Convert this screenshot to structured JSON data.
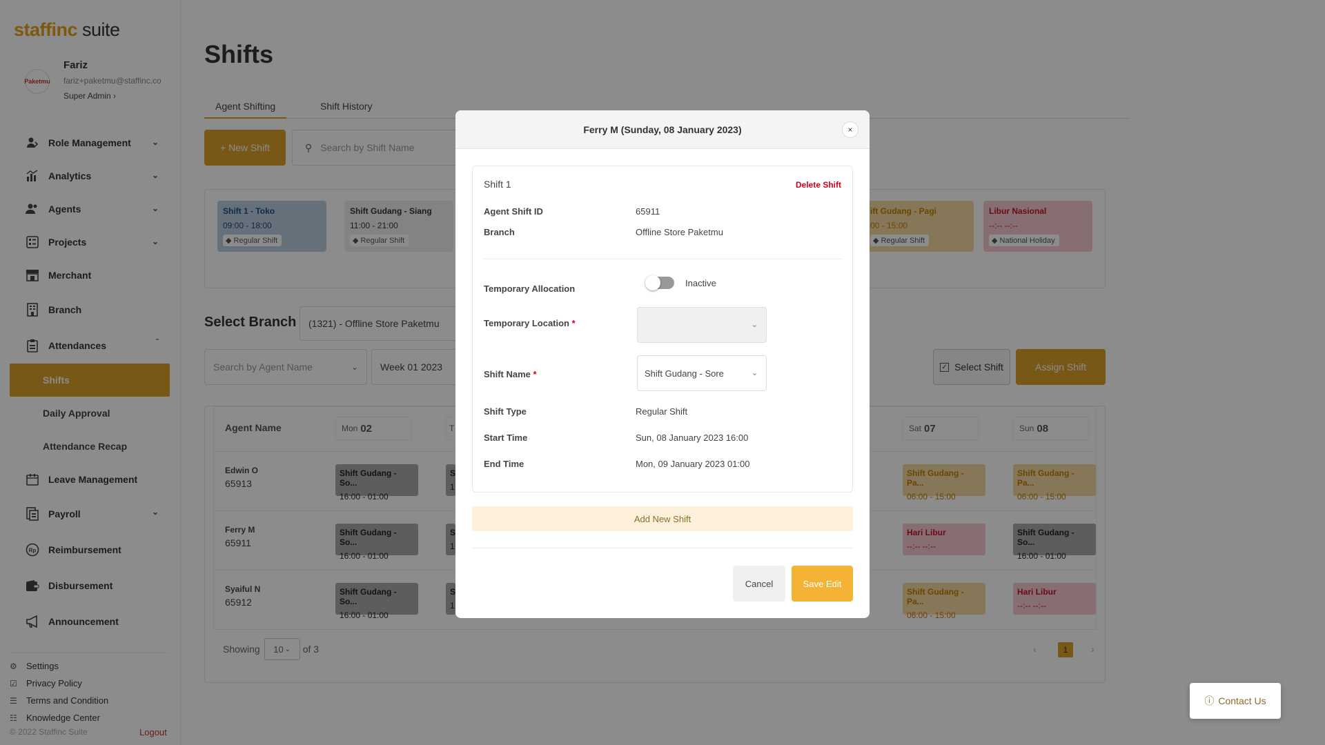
{
  "brand": {
    "logo_a": "staffinc",
    "logo_b": " suite"
  },
  "profile": {
    "name": "Fariz",
    "email": "fariz+paketmu@staffinc.co",
    "role": "Super Admin ›",
    "avatar_text": "Paketmu"
  },
  "sidebar": {
    "items": [
      {
        "label": "Role Management",
        "icon": "role-icon"
      },
      {
        "label": "Analytics",
        "icon": "chart-icon"
      },
      {
        "label": "Agents",
        "icon": "users-icon"
      },
      {
        "label": "Projects",
        "icon": "projects-icon"
      },
      {
        "label": "Merchant",
        "icon": "store-icon"
      },
      {
        "label": "Branch",
        "icon": "building-icon"
      },
      {
        "label": "Attendances",
        "icon": "clipboard-icon"
      },
      {
        "label": "Leave Management",
        "icon": "calendar-icon"
      },
      {
        "label": "Payroll",
        "icon": "payroll-icon"
      },
      {
        "label": "Reimbursement",
        "icon": "rp-icon"
      },
      {
        "label": "Disbursement",
        "icon": "wallet-icon"
      },
      {
        "label": "Announcement",
        "icon": "megaphone-icon"
      }
    ],
    "sub_items": [
      "Shifts",
      "Daily Approval",
      "Attendance Recap"
    ],
    "footer": [
      "Settings",
      "Privacy Policy",
      "Terms and Condition",
      "Knowledge Center"
    ],
    "copyright": "© 2022 Staffinc Suite",
    "logout": "Logout"
  },
  "page": {
    "title": "Shifts",
    "tabs": [
      "Agent Shifting",
      "Shift History"
    ],
    "new_shift": "+  New Shift",
    "search_placeholder": "Search by Shift Name",
    "shift_cards": [
      {
        "name": "Shift 1 - Toko",
        "time": "09:00 - 18:00",
        "tag": "Regular Shift"
      },
      {
        "name": "Shift Gudang - Siang",
        "time": "11:00 - 21:00",
        "tag": "Regular Shift"
      },
      {
        "name": "ift Gudang - Pagi",
        "time": "00 - 15:00",
        "tag": "Regular Shift"
      },
      {
        "name": "Libur Nasional",
        "time": "--:-- --:--",
        "tag": "National Holiday"
      }
    ],
    "select_branch": "Select Branch",
    "branch_value": "(1321) - Offline Store Paketmu",
    "agent_search": "Search by Agent Name",
    "week": "Week 01 2023",
    "select_shift": "Select Shift",
    "assign_shift": "Assign Shift",
    "table": {
      "agent_header": "Agent Name",
      "days": [
        {
          "d": "Mon",
          "n": "02"
        },
        {
          "d": "Sat",
          "n": "07"
        },
        {
          "d": "Sun",
          "n": "08"
        }
      ],
      "tue_partial": "T",
      "rows": [
        {
          "name": "Edwin O",
          "id": "65913",
          "mon": {
            "n": "Shift Gudang - So...",
            "t": "16:00 - 01:00"
          },
          "sat": {
            "n": "Shift Gudang - Pa...",
            "t": "06:00 - 15:00"
          },
          "sun": {
            "n": "Shift Gudang - Pa...",
            "t": "06:00 - 15:00"
          }
        },
        {
          "name": "Ferry M",
          "id": "65911",
          "mon": {
            "n": "Shift Gudang - So...",
            "t": "16:00 - 01:00"
          },
          "sat": {
            "n": "Hari Libur",
            "t": "--:-- --:--"
          },
          "sun": {
            "n": "Shift Gudang - So...",
            "t": "16:00 - 01:00"
          }
        },
        {
          "name": "Syaiful N",
          "id": "65912",
          "mon": {
            "n": "Shift Gudang - So...",
            "t": "16:00 - 01:00"
          },
          "sat": {
            "n": "Shift Gudang - Pa...",
            "t": "06:00 - 15:00"
          },
          "sun": {
            "n": "Hari Libur",
            "t": "--:-- --:--"
          }
        }
      ],
      "partial_letters": [
        "S",
        "1"
      ],
      "showing": "Showing",
      "page_size": "10",
      "of_total": "of 3",
      "page": "1"
    },
    "contact": "Contact Us"
  },
  "modal": {
    "title": "Ferry M (Sunday, 08 January 2023)",
    "close": "×",
    "shift_title": "Shift 1",
    "delete": "Delete Shift",
    "agent_shift_id_label": "Agent Shift ID",
    "agent_shift_id": "65911",
    "branch_label": "Branch",
    "branch": "Offline Store Paketmu",
    "temp_alloc_label": "Temporary Allocation",
    "temp_alloc_state": "Inactive",
    "temp_loc_label": "Temporary Location",
    "shift_name_label": "Shift Name",
    "shift_name": "Shift Gudang - Sore",
    "shift_type_label": "Shift Type",
    "shift_type": "Regular Shift",
    "start_label": "Start Time",
    "start": "Sun, 08 January 2023 16:00",
    "end_label": "End Time",
    "end": "Mon, 09 January 2023 01:00",
    "add_new": "Add New Shift",
    "cancel": "Cancel",
    "save": "Save Edit",
    "required_mark": "*"
  },
  "colors": {
    "accent": "#d9a02a",
    "danger": "#d0021b",
    "save": "#f5b335"
  }
}
